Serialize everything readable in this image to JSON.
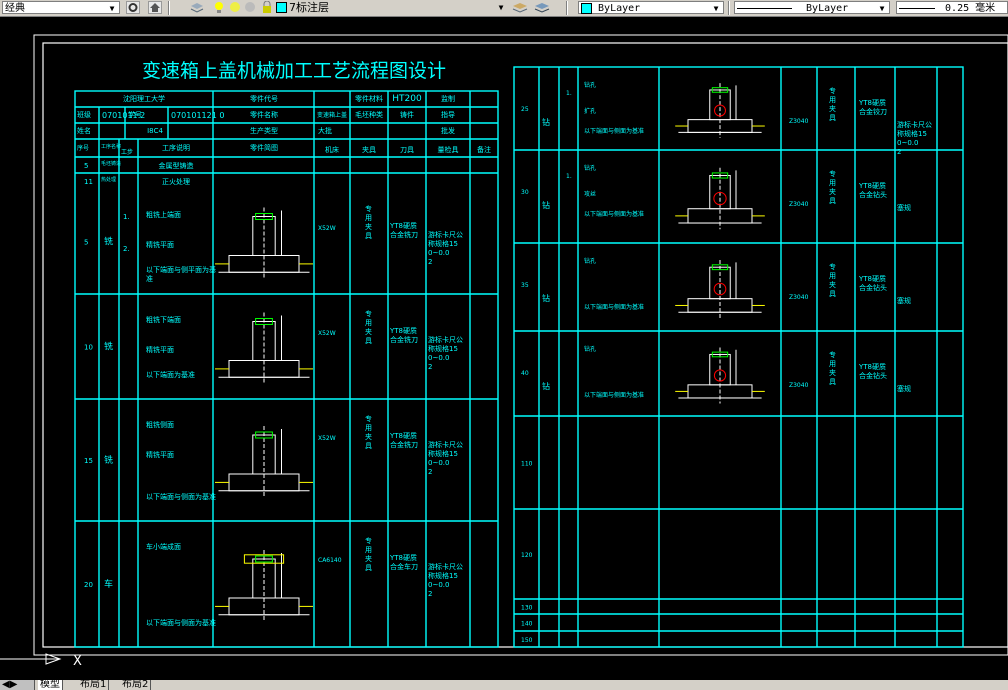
{
  "toolbar": {
    "workspace": "经典",
    "layer_name": "7标注层",
    "color": "ByLayer",
    "linetype": "ByLayer",
    "lineweight": "0.25 毫米",
    "icons": [
      "gear-icon",
      "home-icon",
      "layers-icon",
      "lightbulb-icon",
      "sun-icon",
      "lock-icon",
      "color-swatch-icon",
      "layer-match-icon",
      "layer-prev-icon"
    ]
  },
  "sheet": {
    "title": "变速箱上盖机械加工工艺流程图设计",
    "header": {
      "h1": "沈阳理工大学",
      "h2": "零件代号",
      "h3": "零件材料",
      "h4": "HT200",
      "h5": "监制",
      "class_label": "班级",
      "class_value": "0701011 2",
      "id_label": "学号",
      "id_value": "070101121 0",
      "name_part": "零件名称",
      "material_cond": "变速箱上盖",
      "blank": "毛坯种类",
      "blank_value": "铸件",
      "guide": "指导",
      "name_label": "姓名",
      "name_value": "I8C4",
      "mode": "生产类型",
      "mode_value": "大批",
      "audit": "批发"
    },
    "columns": {
      "no": "序号",
      "proc": "工序名称",
      "step": "工步",
      "desc": "工序说明",
      "sketch": "零件简图",
      "machine": "机床",
      "fixture": "夹具",
      "tool": "刀具",
      "gauge": "量检具",
      "note": "备注"
    },
    "pre_rows": [
      {
        "a": "毛坯铸造",
        "b": "金属型铸造"
      },
      {
        "a": "热处理",
        "b": "正火处理"
      }
    ],
    "pre_row_nos": [
      "5",
      " 11"
    ],
    "left_ops": [
      {
        "no": "5",
        "name": "铣",
        "steps": [
          "1.",
          "2."
        ],
        "lines": [
          "粗铣上端面",
          "精铣平面",
          "以下端面与侧平面为基准"
        ],
        "machine": "X52W",
        "fixture": "专用夹具",
        "tool": "YT8硬质合金铣刀",
        "gauge": "游标卡尺公称规格150~0.02"
      },
      {
        "no": "10",
        "name": "铣",
        "steps": [],
        "lines": [
          "粗铣下端面",
          "精铣平面",
          "以下端面为基准"
        ],
        "machine": "X52W",
        "fixture": "专用夹具",
        "tool": "YT8硬质合金铣刀",
        "gauge": "游标卡尺公称规格150~0.02"
      },
      {
        "no": "15",
        "name": "铣",
        "steps": [],
        "lines": [
          "粗铣侧面",
          "精铣平面",
          "以下端面与侧面为基准"
        ],
        "machine": "X52W",
        "fixture": "专用夹具",
        "tool": "YT8硬质合金铣刀",
        "gauge": "游标卡尺公称规格150~0.02"
      },
      {
        "no": "20",
        "name": "车",
        "steps": [],
        "lines": [
          "车小端成面",
          "以下端面与侧面为基准"
        ],
        "machine": "CA6140",
        "fixture": "专用夹具",
        "tool": "YT8硬质合金车刀",
        "gauge": "游标卡尺公称规格150~0.02"
      }
    ],
    "right_ops": [
      {
        "no": "25",
        "name": "钻",
        "steps": [
          "1."
        ],
        "lines": [
          "钻孔",
          "扩孔",
          "以下端面与侧面为基准"
        ],
        "machine": "Z3040",
        "fixture": "专用夹具",
        "tool": "YT8硬质合金铰刀",
        "gauge": "游标卡尺公称规格150~0.02"
      },
      {
        "no": "30",
        "name": "钻",
        "steps": [
          "1."
        ],
        "lines": [
          "钻孔",
          "攻丝",
          "以下端面与侧面为基准"
        ],
        "machine": "Z3040",
        "fixture": "专用夹具",
        "tool": "YT8硬质合金钻头",
        "gauge": "塞规"
      },
      {
        "no": "35",
        "name": "钻",
        "steps": [],
        "lines": [
          "钻孔",
          "以下端面与侧面为基准"
        ],
        "machine": "Z3040",
        "fixture": "专用夹具",
        "tool": "YT8硬质合金钻头",
        "gauge": "塞规"
      },
      {
        "no": "40",
        "name": "钻",
        "steps": [],
        "lines": [
          "钻孔",
          "以下端面与侧面为基准"
        ],
        "machine": "Z3040",
        "fixture": "专用夹具",
        "tool": "YT8硬质合金钻头",
        "gauge": "塞规"
      }
    ],
    "right_empty_nos": [
      "110",
      "120",
      "130",
      "140",
      "150"
    ]
  },
  "ucs": {
    "x": "X"
  },
  "tabs": [
    "模型",
    "布局1",
    "布局2"
  ]
}
